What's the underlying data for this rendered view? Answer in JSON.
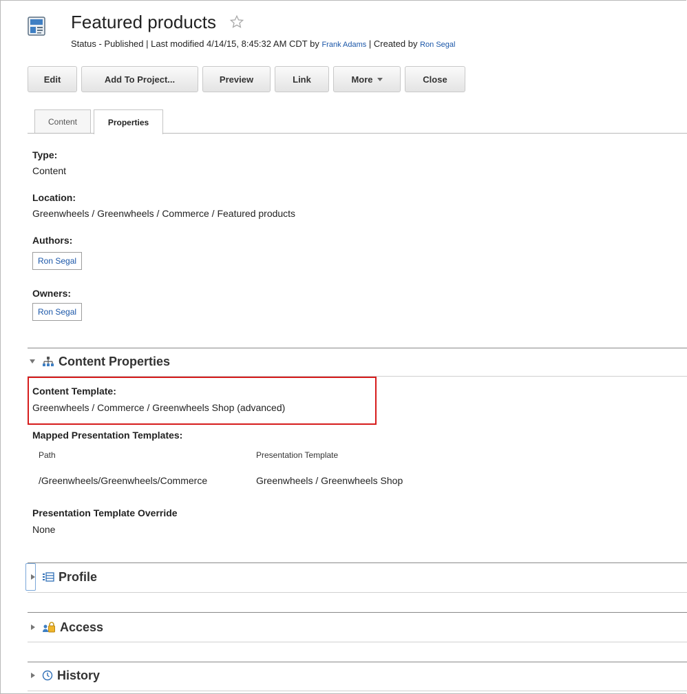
{
  "header": {
    "title": "Featured products",
    "status_prefix": "Status - Published | Last modified 4/14/15, 8:45:32 AM CDT by ",
    "modified_by": "Frank Adams",
    "created_sep": " | Created by ",
    "created_by": "Ron Segal"
  },
  "toolbar": {
    "edit": "Edit",
    "add_to_project": "Add To Project...",
    "preview": "Preview",
    "link": "Link",
    "more": "More",
    "close": "Close"
  },
  "tabs": [
    {
      "label": "Content",
      "active": false
    },
    {
      "label": "Properties",
      "active": true
    }
  ],
  "properties": {
    "type_label": "Type:",
    "type_value": "Content",
    "location_label": "Location:",
    "location_value": "Greenwheels / Greenwheels / Commerce / Featured products",
    "authors_label": "Authors:",
    "authors": [
      "Ron Segal"
    ],
    "owners_label": "Owners:",
    "owners": [
      "Ron Segal"
    ]
  },
  "content_properties": {
    "title": "Content Properties",
    "template_label": "Content Template:",
    "template_value": "Greenwheels / Commerce / Greenwheels Shop (advanced)",
    "mapped_label": "Mapped Presentation Templates:",
    "col_path": "Path",
    "col_template": "Presentation Template",
    "rows": [
      {
        "path": "/Greenwheels/Greenwheels/Commerce",
        "template": "Greenwheels / Greenwheels Shop"
      }
    ],
    "override_label": "Presentation Template Override",
    "override_value": "None"
  },
  "sections": {
    "profile": "Profile",
    "access": "Access",
    "history": "History"
  },
  "colors": {
    "link": "#1a56a8",
    "highlight": "#d61b1b"
  },
  "icons": {
    "document": "content-item-icon",
    "favorite": "star-outline-icon",
    "content_properties": "hierarchy-icon",
    "profile": "list-icon",
    "access": "users-lock-icon",
    "history": "clock-icon"
  }
}
